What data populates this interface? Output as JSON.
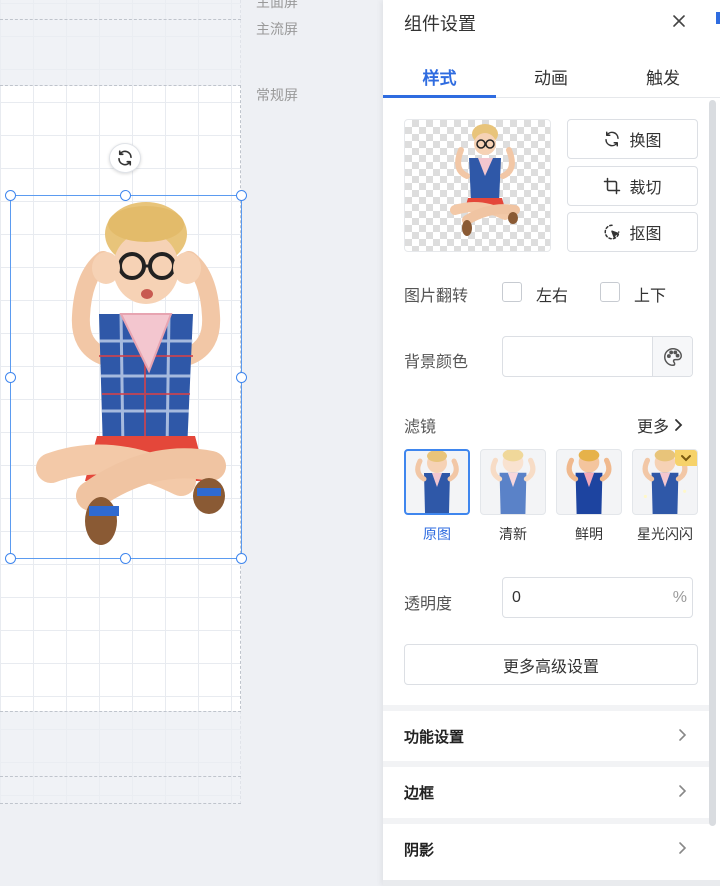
{
  "canvas": {
    "screen_labels": [
      "主面屏",
      "主流屏",
      "常规屏"
    ]
  },
  "panel": {
    "title": "组件设置",
    "tabs": [
      "样式",
      "动画",
      "触发"
    ],
    "active_tab": "样式",
    "image_actions": [
      "换图",
      "裁切",
      "抠图"
    ],
    "flip": {
      "label": "图片翻转",
      "options": [
        "左右",
        "上下"
      ]
    },
    "background": {
      "label": "背景颜色",
      "value": ""
    },
    "filters": {
      "label": "滤镜",
      "more": "更多",
      "items": [
        "原图",
        "清新",
        "鲜明",
        "星光闪闪"
      ],
      "active": "原图"
    },
    "opacity": {
      "label": "透明度",
      "value": "0",
      "unit": "%"
    },
    "advanced_button": "更多高级设置",
    "sections": [
      "功能设置",
      "边框",
      "阴影"
    ]
  },
  "colors": {
    "accent": "#2f6ce0",
    "selection": "#3f86ee"
  },
  "icons": [
    "close-icon",
    "refresh-icon",
    "crop-icon",
    "cutout-icon",
    "palette-icon",
    "chevron-right-icon",
    "rotate-icon"
  ]
}
